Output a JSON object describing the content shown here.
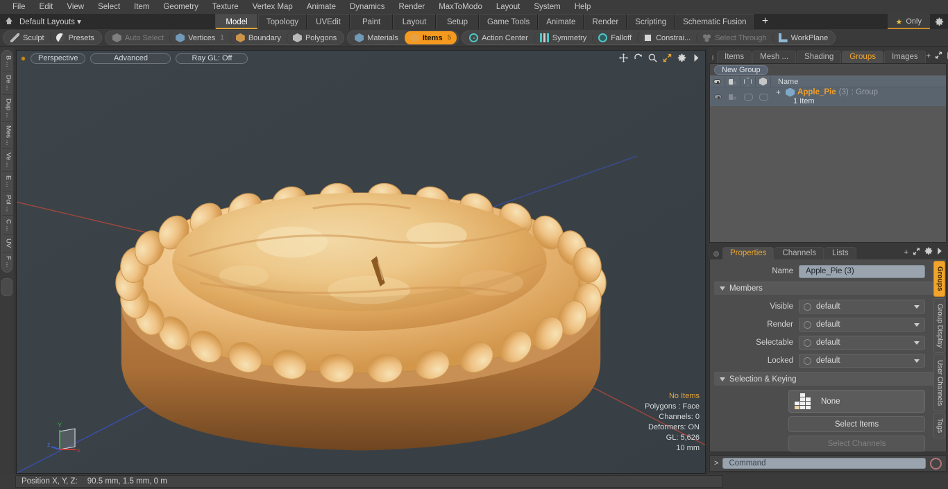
{
  "menubar": {
    "items": [
      "File",
      "Edit",
      "View",
      "Select",
      "Item",
      "Geometry",
      "Texture",
      "Vertex Map",
      "Animate",
      "Dynamics",
      "Render",
      "MaxToModo",
      "Layout",
      "System",
      "Help"
    ]
  },
  "layoutbar": {
    "home_icon": "home-icon",
    "layouts_label": "Default Layouts ▾",
    "tabs": [
      {
        "label": "Model",
        "active": true
      },
      {
        "label": "Topology",
        "active": false
      },
      {
        "label": "UVEdit",
        "active": false
      },
      {
        "label": "Paint",
        "active": false
      },
      {
        "label": "Layout",
        "active": false
      },
      {
        "label": "Setup",
        "active": false
      },
      {
        "label": "Game Tools",
        "active": false
      },
      {
        "label": "Animate",
        "active": false
      },
      {
        "label": "Render",
        "active": false
      },
      {
        "label": "Scripting",
        "active": false
      },
      {
        "label": "Schematic Fusion",
        "active": false
      }
    ],
    "add_label": "+",
    "only_label": "Only",
    "star_icon": "star-icon",
    "gear_icon": "gear-icon"
  },
  "toolbar": {
    "group1": [
      {
        "label": "Sculpt",
        "icon": "pencil-icon",
        "state": "normal",
        "count": ""
      },
      {
        "label": "Presets",
        "icon": "sphere-icon",
        "state": "normal",
        "count": ""
      }
    ],
    "group2": [
      {
        "label": "Auto Select",
        "icon": "cube-grey-icon",
        "state": "dim",
        "count": ""
      },
      {
        "label": "Vertices",
        "icon": "cube-blue-icon",
        "state": "normal",
        "count": "1"
      },
      {
        "label": "Boundary",
        "icon": "cube-orange-icon",
        "state": "normal",
        "count": ""
      },
      {
        "label": "Polygons",
        "icon": "cube-white-icon",
        "state": "normal",
        "count": ""
      }
    ],
    "group3": [
      {
        "label": "Materials",
        "icon": "cube-blue-icon",
        "state": "normal",
        "count": ""
      },
      {
        "label": "Items",
        "icon": "cube-orange-icon",
        "state": "on",
        "count": "5"
      }
    ],
    "group4": [
      {
        "label": "Action Center",
        "icon": "target-icon",
        "state": "normal",
        "count": ""
      },
      {
        "label": "Symmetry",
        "icon": "symmetry-icon",
        "state": "normal",
        "count": ""
      },
      {
        "label": "Falloff",
        "icon": "falloff-icon",
        "state": "normal",
        "count": ""
      },
      {
        "label": "Constrai...",
        "icon": "constraint-icon",
        "state": "normal",
        "count": ""
      },
      {
        "label": "Select Through",
        "icon": "select-through-icon",
        "state": "dim",
        "count": ""
      },
      {
        "label": "WorkPlane",
        "icon": "workplane-icon",
        "state": "normal",
        "count": ""
      }
    ]
  },
  "left_tabs": {
    "items": [
      "B ...",
      "De ...",
      "Dup ...",
      "Mes ...",
      "Ve ...",
      "E ...",
      "Pol ...",
      "C ...",
      "UV",
      "F ..."
    ]
  },
  "viewport": {
    "dot": "record-dot-icon",
    "pills": [
      "Perspective",
      "Advanced",
      "Ray GL: Off"
    ],
    "nav_icons": [
      "move-icon",
      "rotate-icon",
      "magnify-icon",
      "fit-icon",
      "gear-icon",
      "chevron-right-icon"
    ],
    "stats": {
      "no_items": "No Items",
      "polygons": "Polygons : Face",
      "channels": "Channels: 0",
      "deformers": "Deformers: ON",
      "gl": "GL: 5,626",
      "scale": "10 mm"
    },
    "gizmo": {
      "x": "x",
      "y": "Y",
      "z": "z"
    },
    "object": "apple-pie-3d-model"
  },
  "right_panel": {
    "tabs": [
      {
        "label": "Items",
        "active": false
      },
      {
        "label": "Mesh ...",
        "active": false
      },
      {
        "label": "Shading",
        "active": false
      },
      {
        "label": "Groups",
        "active": true
      },
      {
        "label": "Images",
        "active": false
      }
    ],
    "add_tab": "+",
    "expand_icon": "expand-icon",
    "more_icon": "chevron-right-icon",
    "new_group_button": "New Group",
    "list_header": {
      "name": "Name",
      "col_icons": [
        "eye-icon",
        "shade-icon",
        "hex-outline-icon",
        "hex-solid-icon"
      ]
    },
    "row": {
      "name": "Apple_Pie",
      "count": "(3)",
      "type": ": Group",
      "sub": "1 Item",
      "expander": "+"
    }
  },
  "properties": {
    "tabs": [
      {
        "label": "Properties",
        "active": true
      },
      {
        "label": "Channels",
        "active": false
      },
      {
        "label": "Lists",
        "active": false
      }
    ],
    "add_tab": "+",
    "expand_icon": "expand-icon",
    "gear_icon": "gear-icon",
    "more_icon": "chevron-right-icon",
    "name_label": "Name",
    "name_value": "Apple_Pie (3)",
    "members_section": "Members",
    "fields": [
      {
        "label": "Visible",
        "value": "default"
      },
      {
        "label": "Render",
        "value": "default"
      },
      {
        "label": "Selectable",
        "value": "default"
      },
      {
        "label": "Locked",
        "value": "default"
      }
    ],
    "selection_section": "Selection & Keying",
    "none_button": "None",
    "select_items_button": "Select Items",
    "select_channels_button": "Select Channels",
    "more_button": ">>"
  },
  "right_tabs": {
    "items": [
      {
        "label": "Groups",
        "active": true
      },
      {
        "label": "Group Display",
        "active": false
      },
      {
        "label": "User Channels",
        "active": false
      },
      {
        "label": "Tags",
        "active": false
      }
    ]
  },
  "command_bar": {
    "prompt": ">",
    "placeholder": "Command",
    "record_icon": "record-icon"
  },
  "statusbar": {
    "position_label": "Position X, Y, Z:",
    "position_value": "90.5 mm, 1.5 mm, 0 m"
  },
  "colors": {
    "accent_orange": "#f0a42c",
    "active_tab_underline": "#e3a534",
    "viewport_bg": "#3a4248",
    "axis_x": "#b4503c",
    "axis_y": "#3fae3f",
    "axis_z": "#3f5ab4"
  }
}
